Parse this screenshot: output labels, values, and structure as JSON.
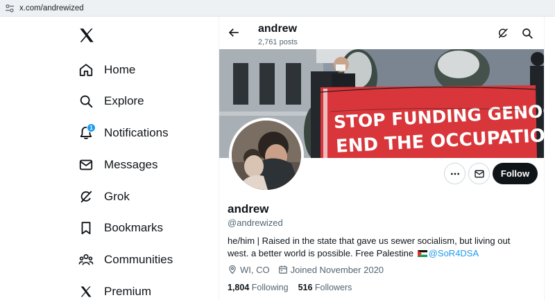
{
  "browser": {
    "url": "x.com/andrewized"
  },
  "sidebar": {
    "items": [
      {
        "label": "Home",
        "icon": "home-icon"
      },
      {
        "label": "Explore",
        "icon": "search-icon"
      },
      {
        "label": "Notifications",
        "icon": "bell-icon",
        "badge": "1"
      },
      {
        "label": "Messages",
        "icon": "mail-icon"
      },
      {
        "label": "Grok",
        "icon": "grok-icon"
      },
      {
        "label": "Bookmarks",
        "icon": "bookmark-icon"
      },
      {
        "label": "Communities",
        "icon": "people-icon"
      },
      {
        "label": "Premium",
        "icon": "x-logo-icon"
      }
    ]
  },
  "header": {
    "name": "andrew",
    "posts": "2,761 posts"
  },
  "banner": {
    "sign_line1": "STOP FUNDING GENOCIDE!",
    "sign_line2": "END THE OCCUPATION!"
  },
  "actions": {
    "follow_label": "Follow"
  },
  "profile": {
    "name": "andrew",
    "handle": "@andrewized",
    "bio_text": "he/him | Raised in the state that gave us sewer socialism, but living out west. a better world is possible. Free Palestine",
    "bio_mention": "@SoR4DSA",
    "location": "WI, CO",
    "joined": "Joined November 2020",
    "following_count": "1,804",
    "following_label": "Following",
    "followers_count": "516",
    "followers_label": "Followers"
  },
  "colors": {
    "accent": "#1d9bf0",
    "text": "#0f1419",
    "muted": "#536471",
    "sign_red": "#d8363a"
  }
}
